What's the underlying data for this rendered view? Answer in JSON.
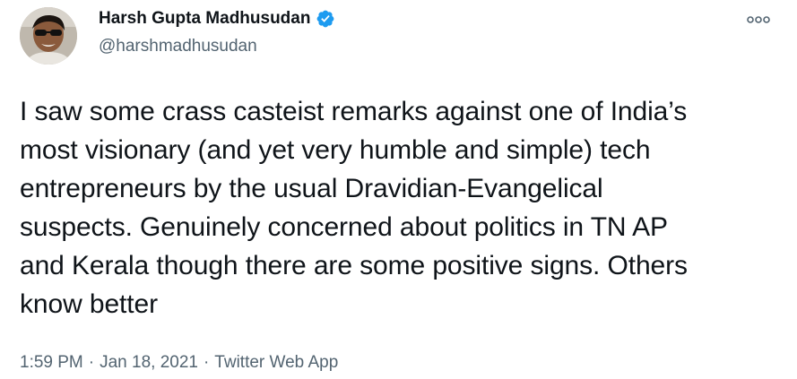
{
  "author": {
    "display_name": "Harsh Gupta Madhusudan",
    "handle": "@harshmadhusudan",
    "verified": true,
    "verified_color": "#1d9bf0"
  },
  "tweet": {
    "text": "I saw some crass casteist remarks against one of India’s\nmost visionary (and yet very humble and simple) tech\nentrepreneurs by the usual Dravidian-Evangelical\nsuspects. Genuinely concerned about politics in TN AP\nand Kerala though there are some positive signs. Others\nknow better"
  },
  "meta": {
    "time": "1:59 PM",
    "date": "Jan 18, 2021",
    "source": "Twitter Web App",
    "separator": "·"
  },
  "icons": {
    "more": "more-options-icon",
    "verified": "verified-badge-icon"
  }
}
